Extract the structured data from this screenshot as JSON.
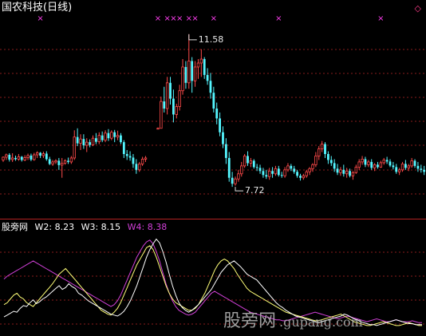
{
  "header": {
    "title": "国农科技(日线)",
    "corner_icon": "diamond-icon"
  },
  "indicator": {
    "name": "股旁网",
    "w2": "W2: 8.23",
    "w3": "W3: 8.15",
    "w4": "W4: 8.38"
  },
  "watermark": {
    "cn": "股旁网",
    "en": ".gupang.com"
  },
  "colors": {
    "up": "#ff4a4a",
    "down": "#54f6ff",
    "grid": "#8a1c1c",
    "w2": "#ffffff",
    "w3": "#ffff78",
    "w4": "#d140d8",
    "marker": "#ff3ef1"
  },
  "chart_data": [
    {
      "type": "candlestick",
      "ylim": [
        7.4,
        12.0
      ],
      "annotations": [
        {
          "label": "11.58",
          "value": 11.58,
          "index": 60
        },
        {
          "label": "7.72",
          "value": 7.72,
          "index": 75
        }
      ],
      "marker_indices": [
        12,
        50,
        53,
        55,
        57,
        60,
        62,
        68,
        89,
        122,
        153,
        170
      ],
      "markers_symbol": "×",
      "candles": [
        [
          8.4,
          8.49,
          8.35,
          8.47
        ],
        [
          8.47,
          8.56,
          8.4,
          8.53
        ],
        [
          8.53,
          8.57,
          8.36,
          8.41
        ],
        [
          8.41,
          8.57,
          8.35,
          8.45
        ],
        [
          8.45,
          8.51,
          8.38,
          8.42
        ],
        [
          8.42,
          8.55,
          8.38,
          8.48
        ],
        [
          8.48,
          8.5,
          8.36,
          8.4
        ],
        [
          8.4,
          8.52,
          8.37,
          8.46
        ],
        [
          8.46,
          8.56,
          8.4,
          8.51
        ],
        [
          8.51,
          8.56,
          8.37,
          8.41
        ],
        [
          8.41,
          8.58,
          8.38,
          8.53
        ],
        [
          8.53,
          8.62,
          8.45,
          8.58
        ],
        [
          8.58,
          8.6,
          8.45,
          8.51
        ],
        [
          8.51,
          8.61,
          8.45,
          8.56
        ],
        [
          8.56,
          8.62,
          8.38,
          8.42
        ],
        [
          8.42,
          8.48,
          8.27,
          8.3
        ],
        [
          8.3,
          8.4,
          8.25,
          8.35
        ],
        [
          8.35,
          8.42,
          8.3,
          8.38
        ],
        [
          8.38,
          8.45,
          8.15,
          8.27
        ],
        [
          8.27,
          8.45,
          7.95,
          8.32
        ],
        [
          8.32,
          8.42,
          8.28,
          8.38
        ],
        [
          8.38,
          8.46,
          8.3,
          8.35
        ],
        [
          8.35,
          8.5,
          8.3,
          8.45
        ],
        [
          8.45,
          9.15,
          8.4,
          8.98
        ],
        [
          8.98,
          9.2,
          8.75,
          8.82
        ],
        [
          8.82,
          9.05,
          8.65,
          8.93
        ],
        [
          8.93,
          9.05,
          8.68,
          8.77
        ],
        [
          8.77,
          8.95,
          8.6,
          8.85
        ],
        [
          8.85,
          8.92,
          8.72,
          8.78
        ],
        [
          8.78,
          9.02,
          8.75,
          8.95
        ],
        [
          8.95,
          9.08,
          8.8,
          8.86
        ],
        [
          8.86,
          9.1,
          8.8,
          9.02
        ],
        [
          9.02,
          9.12,
          8.85,
          8.9
        ],
        [
          8.9,
          9.15,
          8.85,
          9.08
        ],
        [
          9.08,
          9.18,
          8.88,
          8.95
        ],
        [
          8.95,
          9.15,
          8.9,
          9.1
        ],
        [
          9.1,
          9.16,
          8.85,
          8.98
        ],
        [
          8.98,
          9.14,
          8.9,
          9.02
        ],
        [
          9.02,
          9.08,
          8.8,
          8.85
        ],
        [
          8.85,
          8.9,
          8.45,
          8.55
        ],
        [
          8.55,
          8.65,
          8.4,
          8.5
        ],
        [
          8.5,
          8.62,
          8.38,
          8.46
        ],
        [
          8.46,
          8.55,
          8.2,
          8.3
        ],
        [
          8.3,
          8.42,
          8.05,
          8.15
        ],
        [
          8.15,
          8.35,
          8.1,
          8.3
        ],
        [
          8.3,
          8.48,
          8.25,
          8.42
        ],
        [
          8.42,
          8.5,
          8.35,
          8.45
        ],
        null,
        null,
        null,
        [
          9.2,
          9.22,
          9.18,
          9.2
        ],
        [
          9.2,
          10.0,
          9.4,
          9.88
        ],
        [
          9.88,
          10.25,
          9.6,
          9.7
        ],
        [
          9.7,
          10.5,
          9.55,
          10.35
        ],
        [
          10.35,
          10.5,
          9.8,
          9.95
        ],
        [
          9.95,
          10.18,
          9.35,
          9.55
        ],
        [
          9.55,
          9.82,
          9.45,
          9.75
        ],
        [
          9.75,
          10.3,
          9.65,
          10.15
        ],
        [
          10.15,
          10.95,
          10.05,
          10.75
        ],
        [
          10.75,
          10.9,
          10.2,
          10.35
        ],
        [
          10.35,
          11.58,
          10.2,
          10.9
        ],
        [
          10.9,
          11.0,
          10.1,
          10.4
        ],
        [
          10.4,
          10.9,
          10.25,
          10.75
        ],
        [
          10.75,
          10.95,
          10.45,
          10.85
        ],
        [
          10.85,
          11.2,
          10.5,
          10.95
        ],
        [
          10.95,
          11.0,
          10.45,
          10.55
        ],
        [
          10.55,
          10.72,
          10.3,
          10.4
        ],
        [
          10.4,
          10.6,
          9.95,
          10.1
        ],
        [
          10.1,
          10.25,
          9.6,
          9.7
        ],
        [
          9.7,
          9.85,
          9.3,
          9.45
        ],
        [
          9.45,
          9.6,
          9.0,
          9.1
        ],
        [
          9.1,
          9.25,
          8.7,
          8.8
        ],
        [
          8.8,
          8.95,
          8.3,
          8.45
        ],
        [
          8.45,
          8.6,
          7.85,
          7.95
        ],
        [
          7.95,
          8.1,
          7.72,
          7.8
        ],
        [
          7.8,
          7.98,
          7.75,
          7.92
        ],
        [
          7.92,
          8.15,
          7.85,
          8.05
        ],
        [
          8.05,
          8.35,
          7.98,
          8.25
        ],
        [
          8.25,
          8.55,
          8.2,
          8.5
        ],
        [
          8.5,
          8.62,
          8.25,
          8.32
        ],
        [
          8.32,
          8.45,
          8.22,
          8.38
        ],
        [
          8.38,
          8.42,
          8.18,
          8.22
        ],
        [
          8.22,
          8.3,
          8.12,
          8.2
        ],
        [
          8.2,
          8.28,
          8.05,
          8.12
        ],
        [
          8.12,
          8.2,
          7.95,
          8.02
        ],
        [
          8.02,
          8.15,
          7.92,
          7.98
        ],
        [
          7.98,
          8.2,
          7.9,
          8.12
        ],
        [
          8.12,
          8.22,
          7.95,
          8.05
        ],
        [
          8.05,
          8.25,
          8.0,
          8.18
        ],
        [
          8.18,
          8.25,
          7.98,
          8.02
        ],
        [
          8.02,
          8.1,
          7.95,
          8.0
        ],
        [
          8.0,
          8.22,
          7.95,
          8.15
        ],
        [
          8.15,
          8.32,
          8.1,
          8.25
        ],
        [
          8.25,
          8.3,
          8.12,
          8.18
        ],
        [
          8.18,
          8.25,
          8.05,
          8.1
        ],
        [
          8.1,
          8.15,
          7.95,
          8.0
        ],
        [
          8.0,
          8.05,
          7.88,
          7.95
        ],
        [
          7.95,
          8.05,
          7.9,
          8.0
        ],
        [
          8.0,
          8.15,
          7.95,
          8.1
        ],
        [
          8.1,
          8.22,
          8.02,
          8.18
        ],
        [
          8.18,
          8.32,
          8.1,
          8.28
        ],
        [
          8.28,
          8.6,
          8.22,
          8.5
        ],
        [
          8.5,
          8.75,
          8.4,
          8.68
        ],
        [
          8.68,
          8.88,
          8.6,
          8.8
        ],
        [
          8.8,
          8.85,
          8.45,
          8.55
        ],
        [
          8.55,
          8.62,
          8.3,
          8.4
        ],
        [
          8.4,
          8.5,
          8.25,
          8.32
        ],
        [
          8.32,
          8.42,
          8.1,
          8.18
        ],
        [
          8.18,
          8.3,
          8.02,
          8.08
        ],
        [
          8.08,
          8.22,
          8.0,
          8.15
        ],
        [
          8.15,
          8.28,
          7.98,
          8.05
        ],
        [
          8.05,
          8.2,
          7.95,
          8.12
        ],
        [
          8.12,
          8.18,
          7.96,
          8.0
        ],
        [
          8.0,
          8.12,
          7.9,
          8.08
        ],
        [
          8.08,
          8.28,
          8.05,
          8.22
        ],
        [
          8.22,
          8.42,
          8.15,
          8.35
        ],
        [
          8.35,
          8.5,
          8.28,
          8.42
        ],
        [
          8.42,
          8.48,
          8.22,
          8.28
        ],
        [
          8.28,
          8.4,
          8.22,
          8.35
        ],
        [
          8.35,
          8.42,
          8.15,
          8.2
        ],
        [
          8.2,
          8.32,
          8.12,
          8.28
        ],
        [
          8.28,
          8.35,
          8.18,
          8.22
        ],
        [
          8.22,
          8.38,
          8.2,
          8.33
        ],
        [
          8.33,
          8.45,
          8.28,
          8.4
        ],
        [
          8.4,
          8.48,
          8.3,
          8.36
        ],
        [
          8.36,
          8.42,
          8.22,
          8.26
        ],
        [
          8.26,
          8.35,
          8.16,
          8.22
        ],
        [
          8.22,
          8.3,
          8.05,
          8.1
        ],
        [
          8.1,
          8.2,
          8.02,
          8.15
        ],
        [
          8.15,
          8.35,
          8.1,
          8.3
        ],
        [
          8.3,
          8.4,
          8.15,
          8.2
        ],
        [
          8.2,
          8.3,
          8.12,
          8.25
        ],
        [
          8.25,
          8.45,
          8.2,
          8.38
        ],
        [
          8.38,
          8.42,
          8.2,
          8.25
        ],
        [
          8.25,
          8.35,
          8.1,
          8.18
        ],
        [
          8.18,
          8.28,
          8.08,
          8.15
        ],
        [
          8.15,
          8.25,
          8.02,
          8.1
        ],
        [
          8.1,
          8.2,
          8.0,
          8.08
        ]
      ]
    },
    {
      "type": "line",
      "ylim": [
        0,
        100
      ],
      "series": [
        {
          "name": "W2",
          "values": [
            15,
            17,
            19,
            21,
            20,
            24,
            27,
            26,
            30,
            33,
            29,
            31,
            34,
            36,
            39,
            42,
            45,
            48,
            44,
            46,
            50,
            47,
            45,
            40,
            38,
            35,
            32,
            30,
            28,
            26,
            24,
            22,
            20,
            18,
            17,
            16,
            18,
            21,
            26,
            32,
            40,
            48,
            58,
            68,
            78,
            86,
            92,
            97,
            93,
            84,
            73,
            60,
            48,
            38,
            30,
            25,
            22,
            20,
            22,
            25,
            28,
            32,
            36,
            40,
            44,
            50,
            56,
            62,
            66,
            70,
            72,
            74,
            71,
            68,
            64,
            60,
            58,
            56,
            54,
            50,
            46,
            42,
            38,
            34,
            30,
            27,
            25,
            22,
            20,
            18,
            16,
            15,
            14,
            13,
            12,
            11,
            10,
            9,
            10,
            11,
            12,
            13,
            14,
            15,
            16,
            18,
            17,
            15,
            13,
            12,
            10,
            9,
            8,
            7,
            7,
            6,
            7,
            8,
            9,
            10,
            11,
            12,
            11,
            10,
            9,
            8,
            8,
            7,
            7,
            7
          ]
        },
        {
          "name": "W3",
          "values": [
            28,
            30,
            34,
            38,
            40,
            36,
            34,
            30,
            28,
            26,
            30,
            34,
            38,
            42,
            46,
            50,
            55,
            60,
            63,
            66,
            62,
            58,
            54,
            50,
            46,
            42,
            38,
            34,
            30,
            26,
            22,
            20,
            18,
            17,
            20,
            24,
            30,
            38,
            46,
            54,
            62,
            70,
            76,
            82,
            88,
            90,
            86,
            78,
            68,
            58,
            48,
            40,
            34,
            30,
            28,
            26,
            24,
            22,
            22,
            24,
            28,
            34,
            40,
            48,
            56,
            64,
            70,
            74,
            76,
            74,
            70,
            66,
            60,
            55,
            50,
            45,
            42,
            40,
            38,
            36,
            34,
            32,
            30,
            28,
            26,
            24,
            22,
            20,
            19,
            18,
            17,
            16,
            15,
            14,
            13,
            12,
            11,
            11,
            12,
            13,
            14,
            15,
            16,
            17,
            18,
            16,
            14,
            12,
            10,
            9,
            8,
            7,
            6,
            6,
            7,
            8,
            9,
            10,
            9,
            8,
            7,
            6,
            6,
            7,
            8,
            9,
            8,
            7,
            6,
            6
          ]
        },
        {
          "name": "W4",
          "values": [
            55,
            58,
            60,
            62,
            64,
            66,
            68,
            70,
            72,
            74,
            72,
            70,
            68,
            66,
            64,
            62,
            60,
            58,
            56,
            54,
            52,
            50,
            48,
            46,
            44,
            42,
            40,
            38,
            36,
            34,
            32,
            30,
            28,
            26,
            28,
            32,
            38,
            46,
            54,
            62,
            70,
            78,
            84,
            90,
            94,
            96,
            92,
            84,
            74,
            62,
            50,
            40,
            32,
            26,
            22,
            20,
            18,
            17,
            18,
            20,
            24,
            28,
            32,
            36,
            40,
            42,
            40,
            38,
            36,
            34,
            32,
            30,
            28,
            26,
            24,
            22,
            20,
            19,
            18,
            17,
            16,
            15,
            14,
            13,
            12,
            12,
            11,
            11,
            12,
            13,
            14,
            15,
            16,
            17,
            18,
            19,
            20,
            19,
            18,
            17,
            16,
            15,
            14,
            13,
            14,
            15,
            16,
            15,
            14,
            13,
            12,
            11,
            10,
            11,
            12,
            13,
            12,
            11,
            10,
            10,
            11,
            12,
            11,
            10,
            10,
            10,
            11,
            10,
            9,
            9
          ]
        }
      ]
    }
  ]
}
